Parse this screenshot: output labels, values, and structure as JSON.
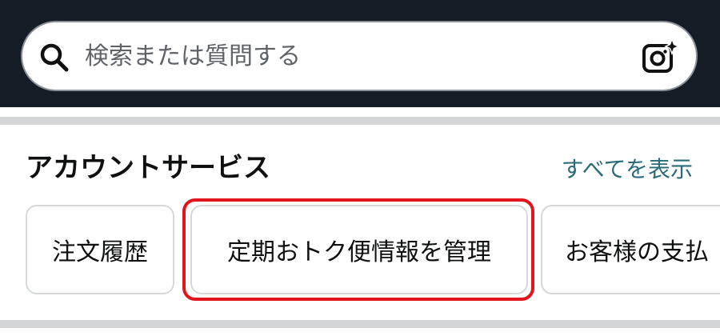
{
  "search": {
    "placeholder": "検索または質問する",
    "icon": "search-icon",
    "camera_icon": "camera-sparkle-icon"
  },
  "account_services": {
    "title": "アカウントサービス",
    "see_all": "すべてを表示",
    "chips": [
      {
        "label": "注文履歴"
      },
      {
        "label": "定期おトク便情報を管理"
      },
      {
        "label": "お客様の支払"
      }
    ]
  },
  "colors": {
    "header_bg": "#141c26",
    "link": "#2a6b78",
    "highlight": "#e3141c",
    "divider": "#d5d6d7"
  }
}
